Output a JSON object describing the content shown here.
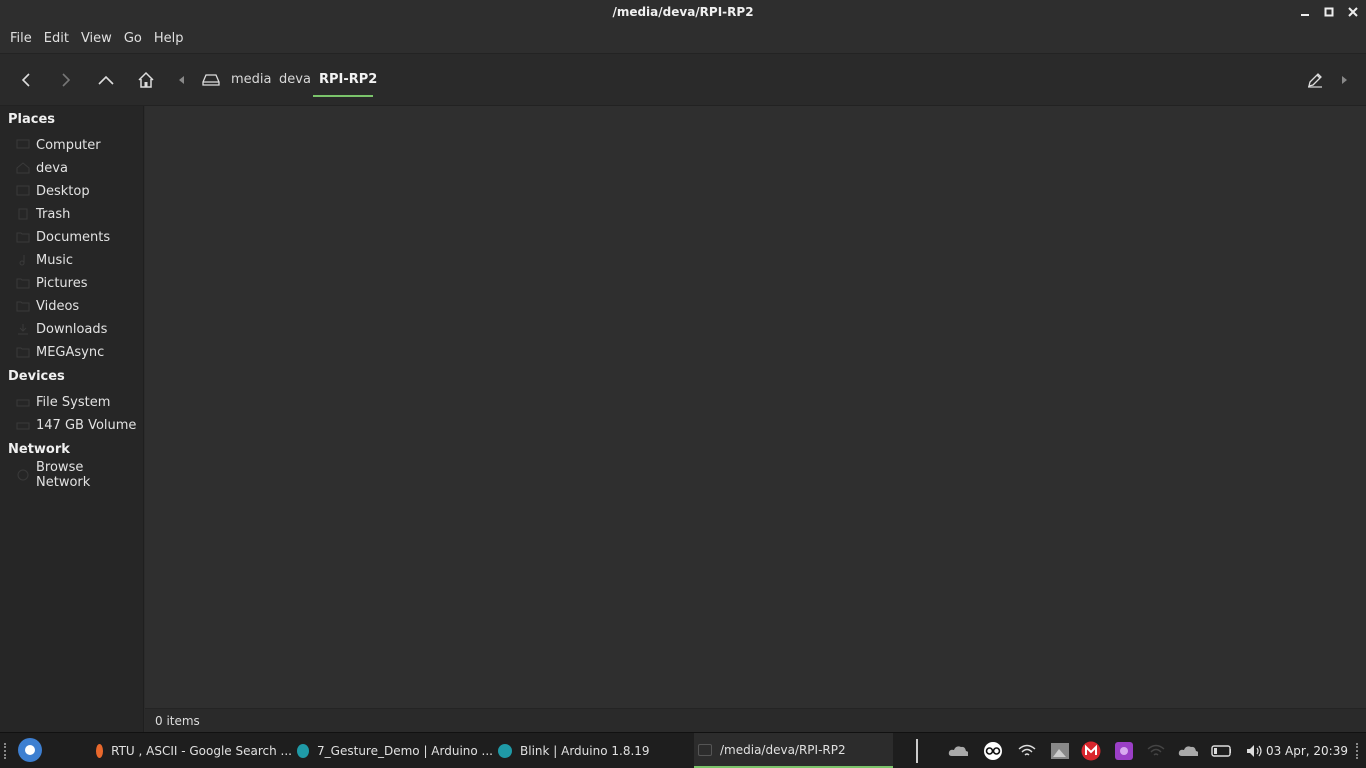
{
  "window": {
    "title": "/media/deva/RPI-RP2"
  },
  "menu": [
    "File",
    "Edit",
    "View",
    "Go",
    "Help"
  ],
  "breadcrumb": {
    "items": [
      "media",
      "deva",
      "RPI-RP2"
    ],
    "active": "RPI-RP2"
  },
  "sidebar": {
    "places_title": "Places",
    "places": [
      {
        "label": "Computer",
        "icon": "computer-icon"
      },
      {
        "label": "deva",
        "icon": "home-icon"
      },
      {
        "label": "Desktop",
        "icon": "desktop-icon"
      },
      {
        "label": "Trash",
        "icon": "trash-icon"
      },
      {
        "label": "Documents",
        "icon": "folder-icon"
      },
      {
        "label": "Music",
        "icon": "music-icon"
      },
      {
        "label": "Pictures",
        "icon": "folder-icon"
      },
      {
        "label": "Videos",
        "icon": "folder-icon"
      },
      {
        "label": "Downloads",
        "icon": "download-icon"
      },
      {
        "label": "MEGAsync",
        "icon": "folder-icon"
      }
    ],
    "devices_title": "Devices",
    "devices": [
      {
        "label": "File System",
        "icon": "drive-icon"
      },
      {
        "label": "147 GB Volume",
        "icon": "drive-icon"
      }
    ],
    "network_title": "Network",
    "network": [
      {
        "label": "Browse Network",
        "icon": "network-icon"
      }
    ]
  },
  "status": {
    "items_text": "0 items"
  },
  "taskbar": {
    "tasks": [
      {
        "label": "RTU , ASCII - Google Search ...",
        "icon": "firefox-icon"
      },
      {
        "label": "7_Gesture_Demo | Arduino ...",
        "icon": "arduino-icon"
      },
      {
        "label": "Blink | Arduino 1.8.19",
        "icon": "arduino-icon"
      },
      {
        "label": "/media/deva/RPI-RP2",
        "icon": "folder-icon"
      }
    ],
    "clock": "03 Apr, 20:39"
  },
  "colors": {
    "accent": "#7bc46b",
    "background": "#2b2b2b",
    "sidebar": "#262626"
  }
}
